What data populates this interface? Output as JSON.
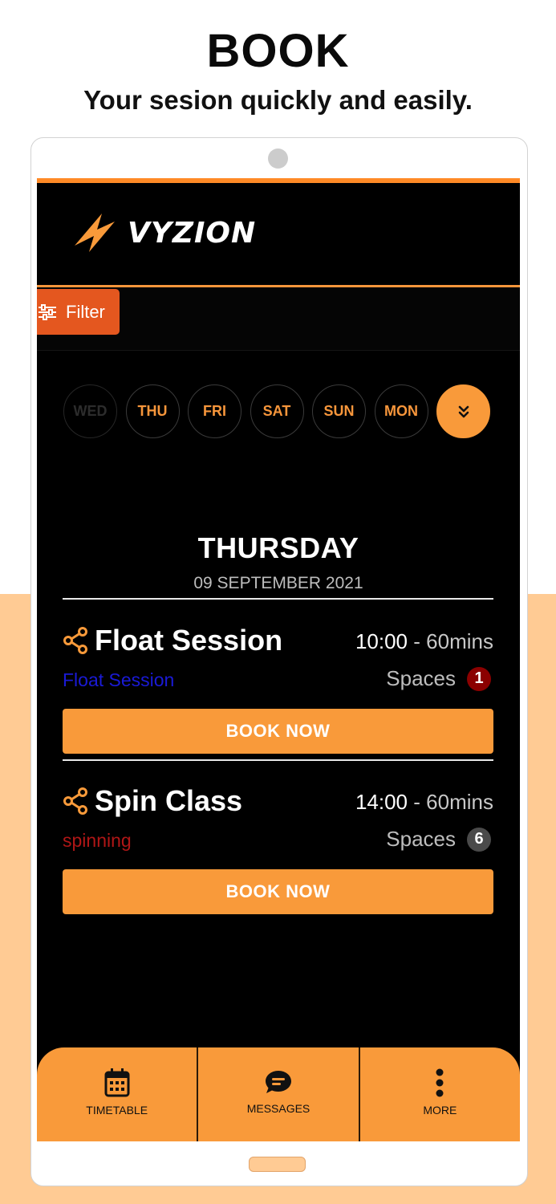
{
  "promo": {
    "headline": "BOOK",
    "subhead": "Your sesion quickly and easily."
  },
  "colors": {
    "accent": "#f99a3a",
    "filter": "#e4571f",
    "screen_bg": "#000000",
    "peach_bg": "#ffcb94"
  },
  "app": {
    "logo_text": "VYZION",
    "filter_label": "Filter",
    "days": [
      {
        "label": "WED",
        "enabled": false
      },
      {
        "label": "THU",
        "enabled": true
      },
      {
        "label": "FRI",
        "enabled": true
      },
      {
        "label": "SAT",
        "enabled": true
      },
      {
        "label": "SUN",
        "enabled": true
      },
      {
        "label": "MON",
        "enabled": true
      }
    ],
    "more_days_icon": "double-chevron-down-icon",
    "selected_day": {
      "name": "THURSDAY",
      "date": "09 SEPTEMBER 2021"
    },
    "sessions": [
      {
        "title": "Float Session",
        "time": "10:00",
        "separator": "-",
        "duration": "60mins",
        "category": "Float Session",
        "category_color": "#1a1ad6",
        "spaces_label": "Spaces",
        "spaces": "1",
        "spaces_badge_color": "#8b0000",
        "book_label": "BOOK NOW",
        "icon": "share-icon"
      },
      {
        "title": "Spin Class",
        "time": "14:00",
        "separator": "-",
        "duration": "60mins",
        "category": "spinning",
        "category_color": "#b01616",
        "spaces_label": "Spaces",
        "spaces": "6",
        "spaces_badge_color": "#4a4a4a",
        "book_label": "BOOK NOW",
        "icon": "share-icon"
      }
    ],
    "bottom_nav": [
      {
        "label": "TIMETABLE",
        "icon": "calendar-icon"
      },
      {
        "label": "MESSAGES",
        "icon": "chat-bubble-icon"
      },
      {
        "label": "MORE",
        "icon": "more-vertical-icon"
      }
    ]
  }
}
